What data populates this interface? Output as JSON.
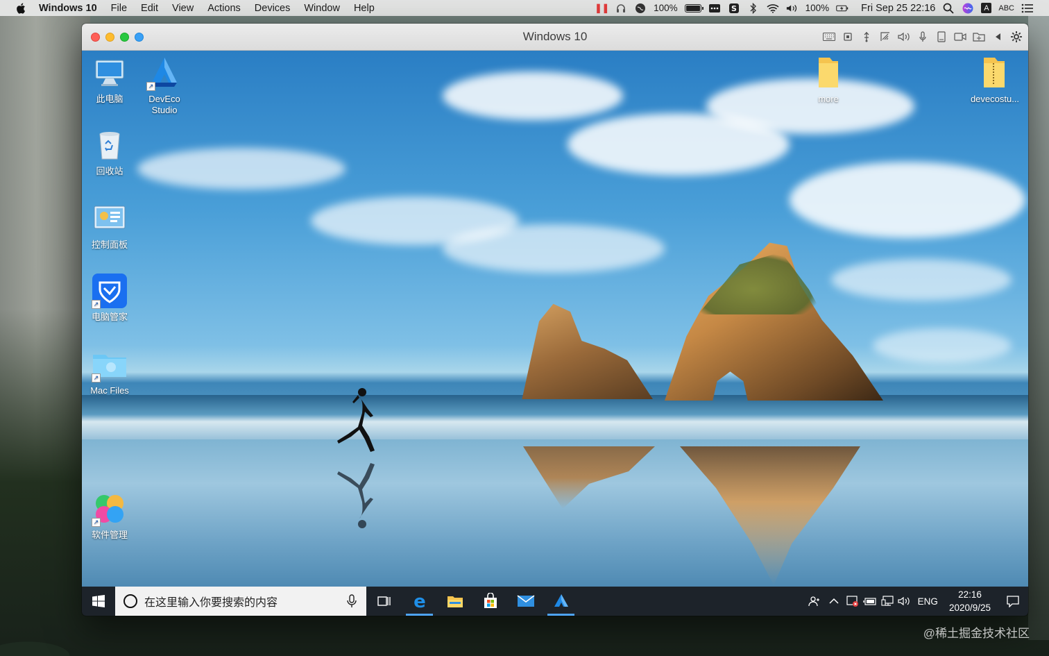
{
  "menubar": {
    "app_name": "Windows 10",
    "items": [
      "File",
      "Edit",
      "View",
      "Actions",
      "Devices",
      "Window",
      "Help"
    ],
    "battery_pct_1": "100%",
    "battery_pct_2": "100%",
    "input_source": "ABC",
    "input_badge": "A",
    "datetime": "Fri Sep 25  22:16"
  },
  "vm": {
    "title": "Windows 10"
  },
  "desktop": {
    "icons_left": [
      {
        "label": "此电脑",
        "icon": "computer-icon"
      },
      {
        "label": "DevEco Studio",
        "icon": "deveco-studio-icon"
      },
      {
        "label": "回收站",
        "icon": "recycle-bin-icon"
      },
      {
        "label": "控制面板",
        "icon": "control-panel-icon"
      },
      {
        "label": "电脑管家",
        "icon": "pc-manager-icon"
      },
      {
        "label": "Mac Files",
        "icon": "mac-files-folder-icon"
      },
      {
        "label": "软件管理",
        "icon": "software-manager-icon"
      }
    ],
    "icons_right": [
      {
        "label": "more",
        "icon": "folder-icon"
      },
      {
        "label": "devecostu...",
        "icon": "zip-folder-icon"
      }
    ]
  },
  "taskbar": {
    "search_placeholder": "在这里输入你要搜索的内容",
    "lang": "ENG",
    "time": "22:16",
    "date": "2020/9/25"
  },
  "watermark": "@稀土掘金技术社区",
  "colors": {
    "taskbar_bg": "#1d232a",
    "accent": "#4ea3f5",
    "menubar_bg": "#ececec"
  }
}
